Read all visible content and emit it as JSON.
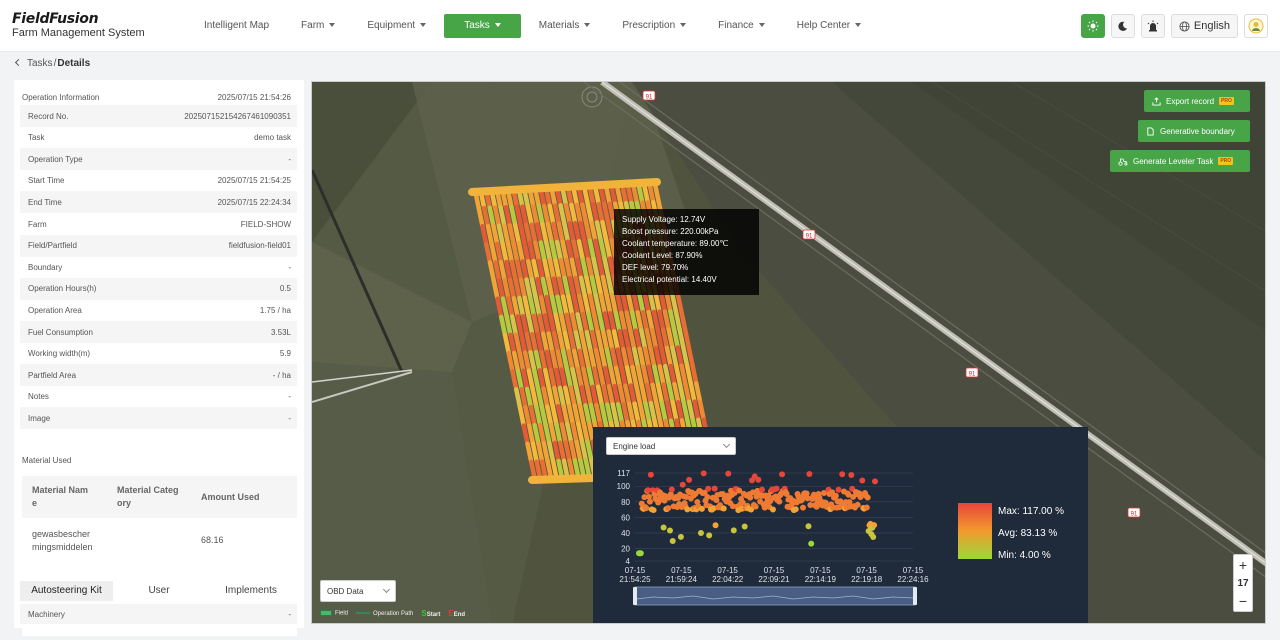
{
  "brand": {
    "logo": "FieldFusion",
    "subtitle": "Farm Management System"
  },
  "nav": [
    {
      "label": "Intelligent Map",
      "caret": false,
      "active": false
    },
    {
      "label": "Farm",
      "caret": true,
      "active": false
    },
    {
      "label": "Equipment",
      "caret": true,
      "active": false
    },
    {
      "label": "Tasks",
      "caret": true,
      "active": true
    },
    {
      "label": "Materials",
      "caret": true,
      "active": false
    },
    {
      "label": "Prescription",
      "caret": true,
      "active": false
    },
    {
      "label": "Finance",
      "caret": true,
      "active": false
    },
    {
      "label": "Help Center",
      "caret": true,
      "active": false
    }
  ],
  "toolbar": {
    "language": "English",
    "accent": "#47a447"
  },
  "breadcrumb": {
    "parent": "Tasks",
    "separator": "/",
    "current": "Details"
  },
  "operation": {
    "header_label": "Operation Information",
    "header_value": "2025/07/15 21:54:26",
    "rows": [
      {
        "label": "Record No.",
        "value": "202507152154267461090351"
      },
      {
        "label": "Task",
        "value": "demo task"
      },
      {
        "label": "Operation Type",
        "value": "-"
      },
      {
        "label": "Start Time",
        "value": "2025/07/15 21:54:25"
      },
      {
        "label": "End Time",
        "value": "2025/07/15 22:24:34"
      },
      {
        "label": "Farm",
        "value": "FIELD-SHOW"
      },
      {
        "label": "Field/Partfield",
        "value": "fieldfusion-field01"
      },
      {
        "label": "Boundary",
        "value": "-"
      },
      {
        "label": "Operation Hours(h)",
        "value": "0.5"
      },
      {
        "label": "Operation Area",
        "value": "1.75 / ha"
      },
      {
        "label": "Fuel Consumption",
        "value": "3.53L"
      },
      {
        "label": "Working width(m)",
        "value": "5.9"
      },
      {
        "label": "Partfield Area",
        "value": "- / ha"
      },
      {
        "label": "Notes",
        "value": "-"
      },
      {
        "label": "Image",
        "value": "-"
      }
    ]
  },
  "material": {
    "title": "Material Used",
    "col_name_1": "Material Nam",
    "col_name_2": "e",
    "col_cat_1": "Material Categ",
    "col_cat_2": "ory",
    "col_amount": "Amount Used",
    "row_name_1": "gewasbescher",
    "row_name_2": "mingsmiddelen",
    "row_amount": "68.16"
  },
  "tabs": [
    "Autosteering Kit",
    "User",
    "Implements"
  ],
  "machinery": {
    "label": "Machinery",
    "value": "-"
  },
  "actions": {
    "export": "Export record",
    "boundary": "Generative boundary",
    "leveler": "Generate Leveler Task",
    "pro": "PRO"
  },
  "road_label": "91",
  "tooltip": [
    "Supply Voltage: 12.74V",
    "Boost pressure: 220.00kPa",
    "Coolant temperature: 89.00℃",
    "Coolant Level: 87.90%",
    "DEF level: 79.70%",
    "Electrical potential: 14.40V"
  ],
  "obd_select": "OBD Data",
  "legend": {
    "field": "Field",
    "path": "Operation Path",
    "start": "Start",
    "end": "End"
  },
  "zoom": {
    "plus": "+",
    "level": "17",
    "minus": "−"
  },
  "chart_data": {
    "type": "line",
    "metric_select": "Engine load",
    "yticks": [
      4,
      20,
      40,
      60,
      80,
      100,
      117
    ],
    "ylim": [
      4,
      117
    ],
    "xticks": [
      {
        "date": "07-15",
        "time": "21:54:25"
      },
      {
        "date": "07-15",
        "time": "21:59:24"
      },
      {
        "date": "07-15",
        "time": "22:04:22"
      },
      {
        "date": "07-15",
        "time": "22:09:21"
      },
      {
        "date": "07-15",
        "time": "22:14:19"
      },
      {
        "date": "07-15",
        "time": "22:19:18"
      },
      {
        "date": "07-15",
        "time": "22:24:16"
      }
    ],
    "max": "Max: 117.00 %",
    "avg": "Avg: 83.13 %",
    "min": "Min: 4.00 %",
    "max_value": 117,
    "avg_value": 83.13,
    "min_value": 4
  }
}
